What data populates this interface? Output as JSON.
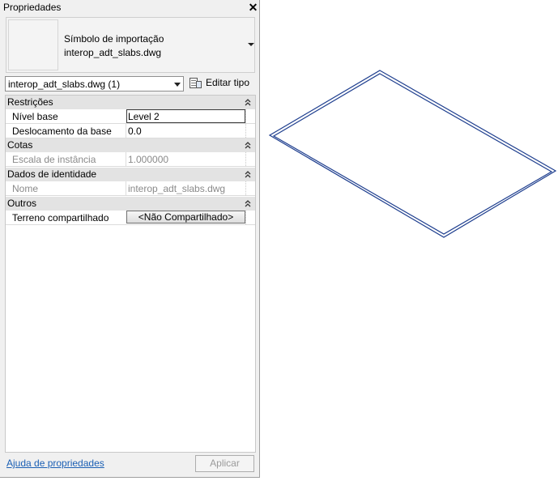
{
  "panel": {
    "title": "Propriedades",
    "close_icon": "close-icon"
  },
  "type_selector": {
    "line1": "Símbolo de importação",
    "line2": "interop_adt_slabs.dwg"
  },
  "instance_filter": {
    "value": "interop_adt_slabs.dwg (1)"
  },
  "edit_type": {
    "label": "Editar tipo",
    "icon": "edit-type-icon"
  },
  "sections": {
    "constraints": {
      "title": "Restrições",
      "rows": [
        {
          "label": "Nível base",
          "value": "Level 2"
        },
        {
          "label": "Deslocamento da base",
          "value": "0.0"
        }
      ]
    },
    "dimensions": {
      "title": "Cotas",
      "rows": [
        {
          "label": "Escala de instância",
          "value": "1.000000"
        }
      ]
    },
    "identity": {
      "title": "Dados de identidade",
      "rows": [
        {
          "label": "Nome",
          "value": "interop_adt_slabs.dwg"
        }
      ]
    },
    "other": {
      "title": "Outros",
      "rows": [
        {
          "label": "Terreno compartilhado",
          "value": "<Não Compartilhado>"
        }
      ]
    }
  },
  "footer": {
    "help_link": "Ajuda de propriedades",
    "apply_label": "Aplicar"
  },
  "colors": {
    "slab_outline": "#1f3f8f",
    "link": "#1a5fb4",
    "section_bg": "#e3e3e3"
  }
}
